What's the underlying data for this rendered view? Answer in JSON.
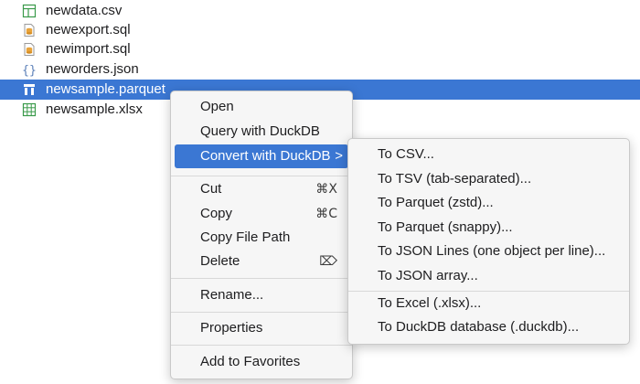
{
  "files": [
    {
      "name": "newdata.csv",
      "icon": "csv-table-icon"
    },
    {
      "name": "newexport.sql",
      "icon": "sql-file-icon"
    },
    {
      "name": "newimport.sql",
      "icon": "sql-file-icon"
    },
    {
      "name": "neworders.json",
      "icon": "json-braces-icon"
    },
    {
      "name": "newsample.parquet",
      "icon": "parquet-columns-icon",
      "selected": true
    },
    {
      "name": "newsample.xlsx",
      "icon": "excel-grid-icon"
    }
  ],
  "context_menu": {
    "items": [
      {
        "label": "Open"
      },
      {
        "label": "Query with DuckDB"
      },
      {
        "label": "Convert with DuckDB",
        "submenu_arrow": ">",
        "highlighted": true
      },
      {
        "label": "Cut",
        "shortcut": "⌘X"
      },
      {
        "label": "Copy",
        "shortcut": "⌘C"
      },
      {
        "label": "Copy File Path"
      },
      {
        "label": "Delete",
        "shortcut": "⌦"
      },
      {
        "label": "Rename..."
      },
      {
        "label": "Properties"
      },
      {
        "label": "Add to Favorites"
      }
    ]
  },
  "convert_submenu": {
    "items": [
      {
        "label": "To CSV..."
      },
      {
        "label": "To TSV (tab-separated)..."
      },
      {
        "label": "To Parquet (zstd)..."
      },
      {
        "label": "To Parquet (snappy)..."
      },
      {
        "label": "To JSON Lines (one object per line)..."
      },
      {
        "label": "To JSON array..."
      },
      {
        "label": "To Excel (.xlsx)..."
      },
      {
        "label": "To DuckDB database (.duckdb)..."
      }
    ]
  },
  "colors": {
    "selection": "#3b77d3",
    "menu_bg": "#f6f6f6",
    "csv_icon": "#3a9a4a",
    "sql_icon": "#e8a33a",
    "json_icon": "#5a7fb8"
  }
}
